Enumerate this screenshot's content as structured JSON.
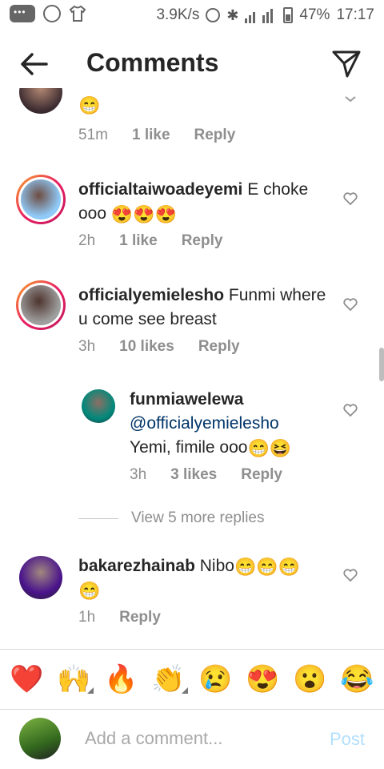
{
  "status_bar": {
    "speed": "3.9K/s",
    "network": "H+",
    "battery": "47%",
    "time": "17:17"
  },
  "header": {
    "title": "Comments"
  },
  "comments": [
    {
      "text": "",
      "emoji": "😁",
      "time": "51m",
      "likes": "1 like",
      "reply": "Reply"
    },
    {
      "username": "officialtaiwoadeyemi",
      "text": "E choke ooo",
      "emoji": "😍😍😍",
      "time": "2h",
      "likes": "1 like",
      "reply": "Reply"
    },
    {
      "username": "officialyemielesho",
      "text": "Funmi where u come see breast",
      "time": "3h",
      "likes": "10 likes",
      "reply": "Reply"
    },
    {
      "username": "funmiawelewa",
      "mention": "@officialyemielesho",
      "text": "Yemi, fimile ooo",
      "emoji": "😁😆",
      "time": "3h",
      "likes": "3 likes",
      "reply": "Reply"
    },
    {
      "username": "bakarezhainab",
      "text": "Nibo",
      "emoji": "😁😁😁",
      "emoji2": "😁",
      "time": "1h",
      "reply": "Reply"
    }
  ],
  "view_more": "View 5 more replies",
  "emoji_bar": [
    "❤️",
    "🙌",
    "🔥",
    "👏",
    "😢",
    "😍",
    "😮",
    "😂"
  ],
  "composer": {
    "placeholder": "Add a comment...",
    "post_label": "Post"
  }
}
